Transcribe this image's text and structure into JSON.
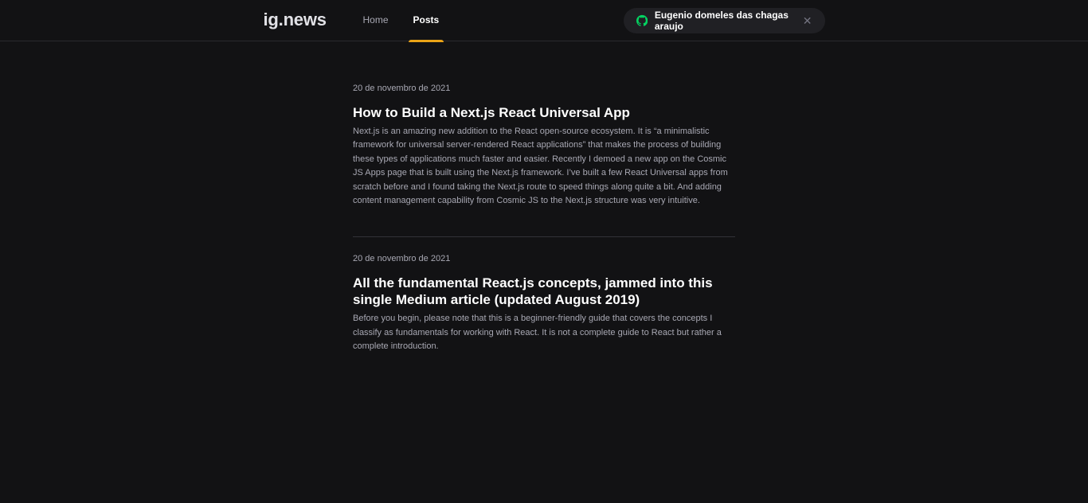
{
  "header": {
    "logo_text": "ig.news",
    "nav": [
      {
        "label": "Home",
        "active": false
      },
      {
        "label": "Posts",
        "active": true
      }
    ],
    "user_name": "Eugenio domeles das chagas araujo",
    "close_glyph": "✕"
  },
  "posts": [
    {
      "date": "20 de novembro de 2021",
      "title": "How to Build a Next.js React Universal App",
      "excerpt": "Next.js is an amazing new addition to the React open-source ecosystem. It is “a minimalistic framework for universal server-rendered React applications” that makes the process of building these types of applications much faster and easier. Recently I demoed a new app on the Cosmic JS Apps page that is built using the Next.js framework. I’ve built a few React Universal apps from scratch before and I found taking the Next.js route to speed things along quite a bit. And adding content management capability from Cosmic JS to the Next.js structure was very intuitive."
    },
    {
      "date": "20 de novembro de 2021",
      "title": "All the fundamental React.js concepts, jammed into this single Medium article (updated August 2019)",
      "excerpt": "Before you begin, please note that this is a beginner-friendly guide that covers the concepts I classify as fundamentals for working with React. It is not a complete guide to React but rather a complete introduction."
    }
  ],
  "colors": {
    "background": "#121214",
    "accent": "#eba417",
    "github_icon": "#04d361"
  },
  "icons": {
    "signin": "github-icon",
    "close": "close-icon"
  }
}
